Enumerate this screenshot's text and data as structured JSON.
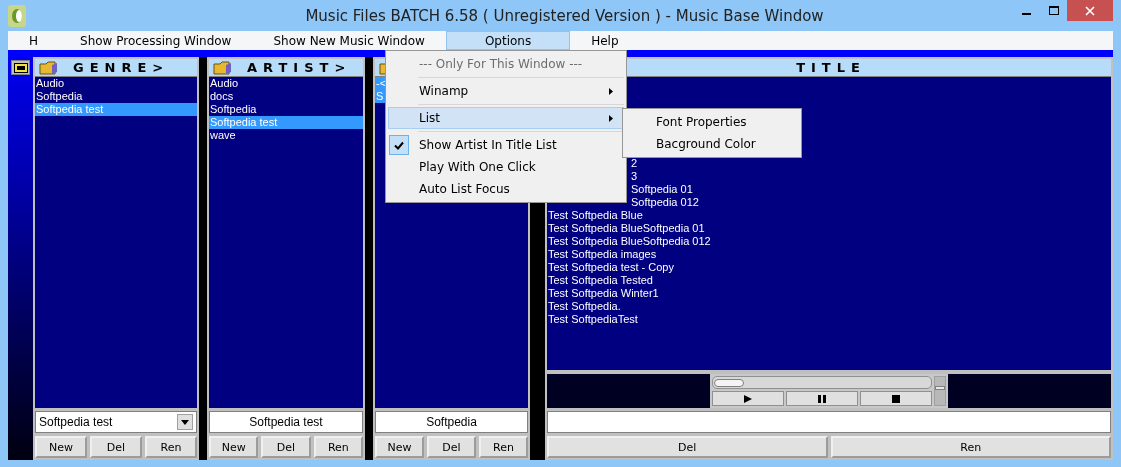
{
  "window": {
    "title": "Music Files BATCH  6.58 ( Unregistered Version ) - Music Base Window"
  },
  "menu_bar": [
    {
      "label": "H",
      "selected": false
    },
    {
      "label": "Show Processing Window",
      "selected": false
    },
    {
      "label": "Show New Music Window",
      "selected": false
    },
    {
      "label": "Options",
      "selected": true
    },
    {
      "label": "Help",
      "selected": false
    }
  ],
  "options_menu": [
    {
      "kind": "header",
      "label": "--- Only For This Window ---"
    },
    {
      "kind": "separator"
    },
    {
      "kind": "submenu",
      "label": "Winamp",
      "selected": false
    },
    {
      "kind": "separator"
    },
    {
      "kind": "submenu",
      "label": "List",
      "selected": true
    },
    {
      "kind": "separator"
    },
    {
      "kind": "check",
      "label": "Show Artist In Title List",
      "checked": true
    },
    {
      "kind": "check",
      "label": "Play With One Click",
      "checked": false
    },
    {
      "kind": "check",
      "label": "Auto List Focus",
      "checked": false
    }
  ],
  "list_submenu": [
    "Font Properties",
    "Bacground Color"
  ],
  "columns": [
    {
      "kind": "side",
      "title": "GENRE>",
      "items": [
        {
          "text": "Audio",
          "selected": false
        },
        {
          "text": "Softpedia",
          "selected": false
        },
        {
          "text": "Softpedia test",
          "selected": true
        }
      ],
      "field": {
        "kind": "combo",
        "value": "Softpedia test"
      },
      "buttons": [
        "New",
        "Del",
        "Ren"
      ]
    },
    {
      "kind": "side",
      "title": "ARTIST>",
      "items": [
        {
          "text": "Audio",
          "selected": false
        },
        {
          "text": "docs",
          "selected": false
        },
        {
          "text": "Softpedia",
          "selected": false
        },
        {
          "text": "Softpedia test",
          "selected": true
        },
        {
          "text": "wave",
          "selected": false
        }
      ],
      "field": {
        "kind": "plain",
        "value": "Softpedia test"
      },
      "buttons": [
        "New",
        "Del",
        "Ren"
      ]
    },
    {
      "kind": "side",
      "items": [
        {
          "text": "-<",
          "selected": true
        },
        {
          "text": "S",
          "selected": true
        }
      ],
      "field": {
        "kind": "plain",
        "value": "Softpedia"
      },
      "buttons": [
        "New",
        "Del",
        "Ren"
      ]
    },
    {
      "kind": "main",
      "title": "TITLE",
      "items": [
        {
          "text": "2",
          "kind": "covered"
        },
        {
          "text": "3",
          "kind": "covered"
        },
        {
          "text": "Softpedia 01",
          "kind": "covered"
        },
        {
          "text": "Softpedia 012",
          "kind": "covered"
        },
        {
          "text": "Test Softpedia Blue",
          "kind": "plain"
        },
        {
          "text": "Test Softpedia BlueSoftpedia 01",
          "kind": "plain"
        },
        {
          "text": "Test Softpedia BlueSoftpedia 012",
          "kind": "plain"
        },
        {
          "text": "Test Softpedia images",
          "kind": "plain"
        },
        {
          "text": "Test Softpedia test - Copy",
          "kind": "plain"
        },
        {
          "text": "Test Softpedia Tested",
          "kind": "plain"
        },
        {
          "text": "Test Softpedia Winter1",
          "kind": "plain"
        },
        {
          "text": "Test Softpedia.",
          "kind": "plain"
        },
        {
          "text": "Test SoftpediaTest",
          "kind": "plain"
        }
      ],
      "player": {
        "seek": {
          "level": 0.14
        },
        "volume": {
          "level": 0.6
        }
      },
      "field": {
        "kind": "plain"
      },
      "buttons": [
        "Del",
        "Ren"
      ]
    }
  ]
}
